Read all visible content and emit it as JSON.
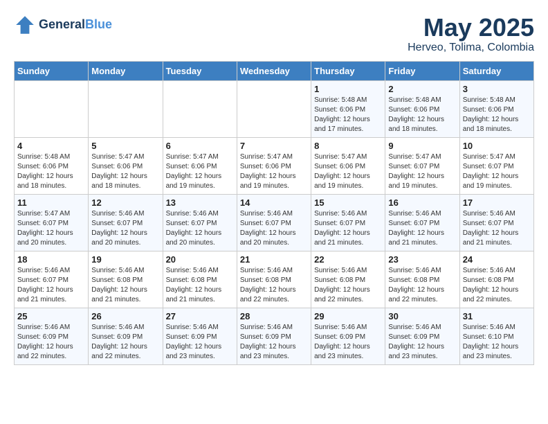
{
  "header": {
    "logo_line1": "General",
    "logo_line2": "Blue",
    "month": "May 2025",
    "location": "Herveo, Tolima, Colombia"
  },
  "weekdays": [
    "Sunday",
    "Monday",
    "Tuesday",
    "Wednesday",
    "Thursday",
    "Friday",
    "Saturday"
  ],
  "weeks": [
    [
      {
        "day": "",
        "text": ""
      },
      {
        "day": "",
        "text": ""
      },
      {
        "day": "",
        "text": ""
      },
      {
        "day": "",
        "text": ""
      },
      {
        "day": "1",
        "text": "Sunrise: 5:48 AM\nSunset: 6:06 PM\nDaylight: 12 hours\nand 17 minutes."
      },
      {
        "day": "2",
        "text": "Sunrise: 5:48 AM\nSunset: 6:06 PM\nDaylight: 12 hours\nand 18 minutes."
      },
      {
        "day": "3",
        "text": "Sunrise: 5:48 AM\nSunset: 6:06 PM\nDaylight: 12 hours\nand 18 minutes."
      }
    ],
    [
      {
        "day": "4",
        "text": "Sunrise: 5:48 AM\nSunset: 6:06 PM\nDaylight: 12 hours\nand 18 minutes."
      },
      {
        "day": "5",
        "text": "Sunrise: 5:47 AM\nSunset: 6:06 PM\nDaylight: 12 hours\nand 18 minutes."
      },
      {
        "day": "6",
        "text": "Sunrise: 5:47 AM\nSunset: 6:06 PM\nDaylight: 12 hours\nand 19 minutes."
      },
      {
        "day": "7",
        "text": "Sunrise: 5:47 AM\nSunset: 6:06 PM\nDaylight: 12 hours\nand 19 minutes."
      },
      {
        "day": "8",
        "text": "Sunrise: 5:47 AM\nSunset: 6:06 PM\nDaylight: 12 hours\nand 19 minutes."
      },
      {
        "day": "9",
        "text": "Sunrise: 5:47 AM\nSunset: 6:07 PM\nDaylight: 12 hours\nand 19 minutes."
      },
      {
        "day": "10",
        "text": "Sunrise: 5:47 AM\nSunset: 6:07 PM\nDaylight: 12 hours\nand 19 minutes."
      }
    ],
    [
      {
        "day": "11",
        "text": "Sunrise: 5:47 AM\nSunset: 6:07 PM\nDaylight: 12 hours\nand 20 minutes."
      },
      {
        "day": "12",
        "text": "Sunrise: 5:46 AM\nSunset: 6:07 PM\nDaylight: 12 hours\nand 20 minutes."
      },
      {
        "day": "13",
        "text": "Sunrise: 5:46 AM\nSunset: 6:07 PM\nDaylight: 12 hours\nand 20 minutes."
      },
      {
        "day": "14",
        "text": "Sunrise: 5:46 AM\nSunset: 6:07 PM\nDaylight: 12 hours\nand 20 minutes."
      },
      {
        "day": "15",
        "text": "Sunrise: 5:46 AM\nSunset: 6:07 PM\nDaylight: 12 hours\nand 21 minutes."
      },
      {
        "day": "16",
        "text": "Sunrise: 5:46 AM\nSunset: 6:07 PM\nDaylight: 12 hours\nand 21 minutes."
      },
      {
        "day": "17",
        "text": "Sunrise: 5:46 AM\nSunset: 6:07 PM\nDaylight: 12 hours\nand 21 minutes."
      }
    ],
    [
      {
        "day": "18",
        "text": "Sunrise: 5:46 AM\nSunset: 6:07 PM\nDaylight: 12 hours\nand 21 minutes."
      },
      {
        "day": "19",
        "text": "Sunrise: 5:46 AM\nSunset: 6:08 PM\nDaylight: 12 hours\nand 21 minutes."
      },
      {
        "day": "20",
        "text": "Sunrise: 5:46 AM\nSunset: 6:08 PM\nDaylight: 12 hours\nand 21 minutes."
      },
      {
        "day": "21",
        "text": "Sunrise: 5:46 AM\nSunset: 6:08 PM\nDaylight: 12 hours\nand 22 minutes."
      },
      {
        "day": "22",
        "text": "Sunrise: 5:46 AM\nSunset: 6:08 PM\nDaylight: 12 hours\nand 22 minutes."
      },
      {
        "day": "23",
        "text": "Sunrise: 5:46 AM\nSunset: 6:08 PM\nDaylight: 12 hours\nand 22 minutes."
      },
      {
        "day": "24",
        "text": "Sunrise: 5:46 AM\nSunset: 6:08 PM\nDaylight: 12 hours\nand 22 minutes."
      }
    ],
    [
      {
        "day": "25",
        "text": "Sunrise: 5:46 AM\nSunset: 6:09 PM\nDaylight: 12 hours\nand 22 minutes."
      },
      {
        "day": "26",
        "text": "Sunrise: 5:46 AM\nSunset: 6:09 PM\nDaylight: 12 hours\nand 22 minutes."
      },
      {
        "day": "27",
        "text": "Sunrise: 5:46 AM\nSunset: 6:09 PM\nDaylight: 12 hours\nand 23 minutes."
      },
      {
        "day": "28",
        "text": "Sunrise: 5:46 AM\nSunset: 6:09 PM\nDaylight: 12 hours\nand 23 minutes."
      },
      {
        "day": "29",
        "text": "Sunrise: 5:46 AM\nSunset: 6:09 PM\nDaylight: 12 hours\nand 23 minutes."
      },
      {
        "day": "30",
        "text": "Sunrise: 5:46 AM\nSunset: 6:09 PM\nDaylight: 12 hours\nand 23 minutes."
      },
      {
        "day": "31",
        "text": "Sunrise: 5:46 AM\nSunset: 6:10 PM\nDaylight: 12 hours\nand 23 minutes."
      }
    ]
  ]
}
